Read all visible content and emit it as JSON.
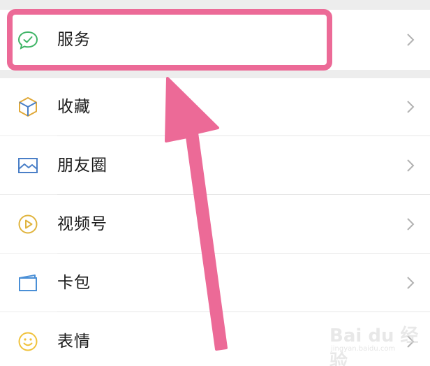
{
  "menu": {
    "items": [
      {
        "label": "服务",
        "icon": "service-chat-check-icon"
      },
      {
        "label": "收藏",
        "icon": "favorites-cube-icon"
      },
      {
        "label": "朋友圈",
        "icon": "moments-picture-icon"
      },
      {
        "label": "视频号",
        "icon": "channels-play-icon"
      },
      {
        "label": "卡包",
        "icon": "card-wallet-icon"
      },
      {
        "label": "表情",
        "icon": "sticker-smile-icon"
      }
    ]
  },
  "annotation": {
    "highlight_color": "#ec6a97",
    "arrow_color": "#ec6a97",
    "target": "服务"
  },
  "watermark": {
    "brand": "Bai du 经验",
    "url": "jingyan.baidu.com"
  },
  "colors": {
    "background": "#ededed",
    "row": "#ffffff",
    "chevron": "#b2b2b2",
    "service_icon": "#3fb466",
    "favorites_icon": "#e0a93a",
    "moments_icon": "#4a7fc7",
    "channels_icon": "#e0b43e",
    "card_icon": "#4a8fd6",
    "sticker_icon": "#f0c23c"
  }
}
